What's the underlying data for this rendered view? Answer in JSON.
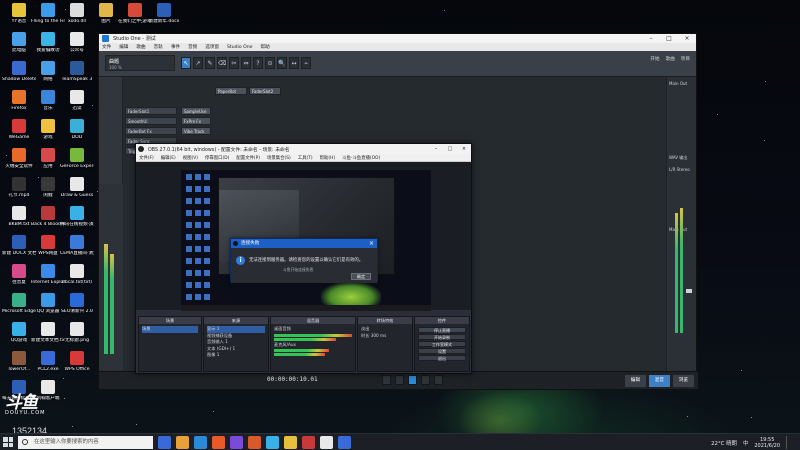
{
  "desktop": {
    "icons": [
      {
        "label": "YY语音",
        "color": "#e8c43a"
      },
      {
        "label": "Flling to the Finish 雅...",
        "color": "#3a9be8"
      },
      {
        "label": "xodo.dll",
        "color": "#dcdcdc"
      },
      {
        "label": "图片",
        "color": "#e0b84a"
      },
      {
        "label": "在我们之中·游戏攻略...",
        "color": "#d64a3a"
      },
      {
        "label": "新建新年.docx",
        "color": "#2b5fb8"
      },
      {
        "label": "此电脑",
        "color": "#4aa0e8"
      },
      {
        "label": "我爱偏故功",
        "color": "#3cb4e8"
      },
      {
        "label": "公众号",
        "color": "#e8e8e8"
      },
      {
        "label": "Shadow Deleter",
        "color": "#3a6ad0"
      },
      {
        "label": "网络",
        "color": "#4aa0e8"
      },
      {
        "label": "TeamSpeak 3",
        "color": "#2a5a9a"
      },
      {
        "label": "Firefox",
        "color": "#e8742a"
      },
      {
        "label": "音乐",
        "color": "#3a86d8"
      },
      {
        "label": "迅读",
        "color": "#e8e8e8"
      },
      {
        "label": "WeGame",
        "color": "#d83a3a"
      },
      {
        "label": "游戏",
        "color": "#f0c040"
      },
      {
        "label": "DOD",
        "color": "#3ab0d8"
      },
      {
        "label": "火绒安全软件",
        "color": "#e86a2a"
      },
      {
        "label": "应用",
        "color": "#d84a4a"
      },
      {
        "label": "GeForce Experience",
        "color": "#78b83a"
      },
      {
        "label": "礼节.mp4",
        "color": "#333333"
      },
      {
        "label": "闲鲤",
        "color": "#3a3a3a"
      },
      {
        "label": "Draw & Guess",
        "color": "#e8e8e8"
      },
      {
        "label": "BKBM.txt",
        "color": "#e8e8e8"
      },
      {
        "label": "Back 4 Blood Beta",
        "color": "#b83a3a"
      },
      {
        "label": "腾讯在线视频·演生...",
        "color": "#3ab0e8"
      },
      {
        "label": "新建 DOCX 文档.docx",
        "color": "#2b5fb8"
      },
      {
        "label": "WPS网盘",
        "color": "#d83a3a"
      },
      {
        "label": "CEMA直播间·清大区",
        "color": "#3a7ad8"
      },
      {
        "label": "往昔夏",
        "color": "#d84a8a"
      },
      {
        "label": "Internet Explorer",
        "color": "#3a8ae8"
      },
      {
        "label": "dbcal.txt(txt)",
        "color": "#e8e8e8"
      },
      {
        "label": "Microsoft Edge",
        "color": "#3ab08a"
      },
      {
        "label": "QQ 浏览器",
        "color": "#3a9ae8"
      },
      {
        "label": "SEO清新兴 2.0",
        "color": "#2a6ad8"
      },
      {
        "label": "QQ游戏",
        "color": "#3ab0e8"
      },
      {
        "label": "新建文本文档.txt",
        "color": "#e8e8e8"
      },
      {
        "label": "无标题.png",
        "color": "#e8e8e8"
      },
      {
        "label": "TowerOf...",
        "color": "#8a5a3a"
      },
      {
        "label": "PCL2.exe",
        "color": "#3a6ad8"
      },
      {
        "label": "WPS Office",
        "color": "#d83a3a"
      },
      {
        "label": "每天速播标准板.docx",
        "color": "#2b5fb8"
      },
      {
        "label": "凯翰客户端",
        "color": "#e8e8e8"
      }
    ]
  },
  "studio": {
    "title": "Studio One - 测试",
    "menus": [
      "文件",
      "编辑",
      "歌曲",
      "音轨",
      "事件",
      "音频",
      "选项窗",
      "Studio One",
      "帮助"
    ],
    "song_name": "曲题",
    "song_sub": "100 %",
    "tools": [
      "↖",
      "↗",
      "✎",
      "⌫",
      "✂",
      "⇔",
      "?",
      "⊙",
      "🔍",
      "↔",
      "⌁"
    ],
    "right_labels": [
      "开始",
      "歌曲",
      "项目"
    ],
    "track_labels": [
      "FaderSlot1",
      "SmoothUi",
      "FaderBot Fx",
      "Fader Sync",
      "TriggerSu",
      "SampleUse",
      "FxPre Fx",
      "Vibe Track",
      "PaperBot",
      "FaderSlot2"
    ],
    "time": "00:00:00:10.01",
    "bottom_tabs": [
      "编辑",
      "混音",
      "浏览"
    ],
    "mixer_labels": [
      "Main Out",
      "WAV 输出",
      "L/R Stereo",
      "Main Out"
    ]
  },
  "obs": {
    "title": "OBS 27.0.1(64 bit, windows) - 配置文件: 未命名 - 场景: 未命名",
    "menus": [
      "文件(F)",
      "编辑(E)",
      "视图(V)",
      "停靠窗口(D)",
      "配置文件(P)",
      "场景集合(S)",
      "工具(T)",
      "帮助(H)",
      "斗鱼·斗鱼直播(OO)"
    ],
    "docks": {
      "scenes": {
        "title": "场景",
        "items": [
          "场景"
        ]
      },
      "sources": {
        "title": "来源",
        "items": [
          "显示 1",
          "视频捕获设备",
          "音频输入 1",
          "文本 (GDI+) 1",
          "图像 1"
        ]
      },
      "mixer": {
        "title": "混音器",
        "channels": [
          "桌面音频",
          "麦克风/Aux"
        ]
      },
      "transitions": {
        "title": "转场特效",
        "items": [
          "淡出",
          "时长 300 ms"
        ]
      },
      "controls": {
        "title": "控件",
        "buttons": [
          "停止直播",
          "开始录制",
          "工作室模式",
          "设置",
          "退出"
        ]
      }
    }
  },
  "dialog": {
    "title": "连接失败",
    "message": "无法连接到服务器。请检查您的设置以确认它们是有效的。",
    "sub": "斗鱼开始连接失败",
    "ok": "确定"
  },
  "watermark": {
    "brand": "斗鱼",
    "brand_sub": "DOUYU.COM",
    "room_id": "1352134"
  },
  "taskbar": {
    "search_placeholder": "在这里输入你要搜索的内容",
    "apps": [
      "#3a6ad8",
      "#e8a03a",
      "#2a8ad8",
      "#e85a2a",
      "#7a4ad8",
      "#d85a2a",
      "#3ab0e8",
      "#e8c040",
      "#c83a3a",
      "#e8e8e8",
      "#3a6ad8"
    ],
    "weather": "22°C 晴朗",
    "time": "19:55",
    "date": "2021/6/20",
    "ime": "中"
  }
}
